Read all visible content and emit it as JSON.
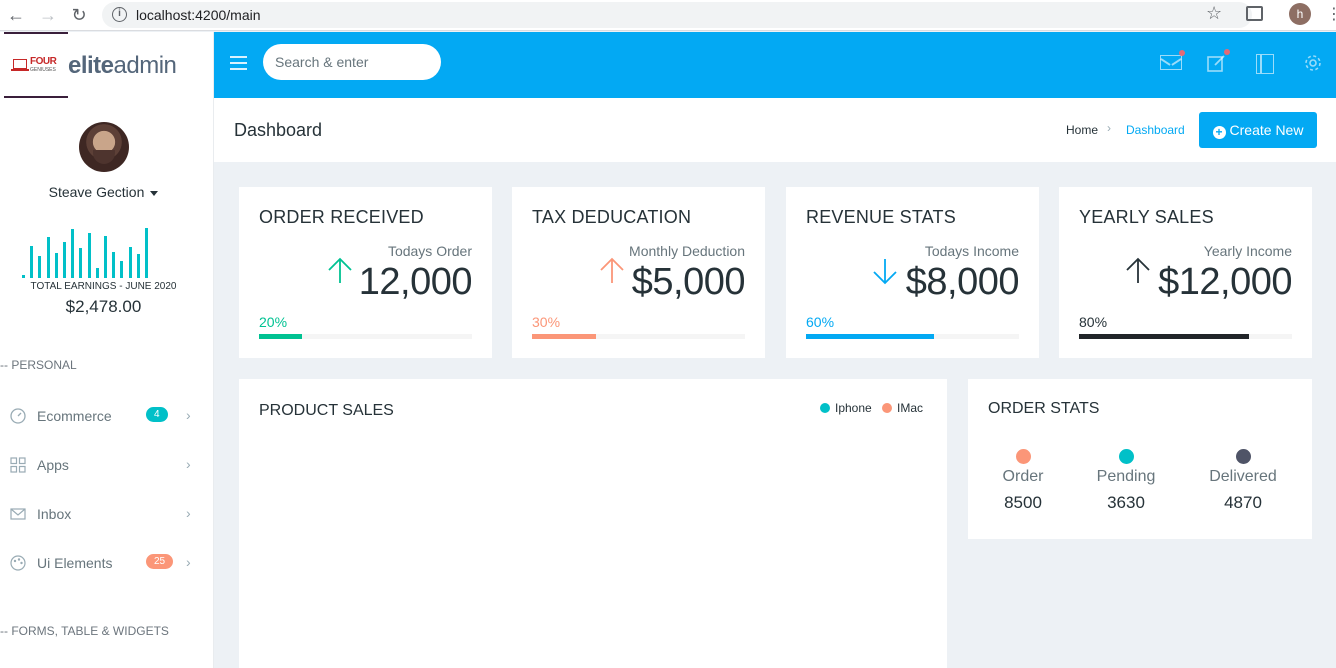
{
  "browser": {
    "url": "localhost:4200/main",
    "profile_initial": "h"
  },
  "brand": {
    "logo_top": "FOUR",
    "logo_bottom": "GENIUSES",
    "name_bold": "elite",
    "name_light": "admin"
  },
  "user": {
    "name": "Steave Gection"
  },
  "earnings": {
    "label": "TOTAL EARNINGS - JUNE 2020",
    "value": "$2,478.00",
    "spark_color": "#01c0c8",
    "bars": [
      0.06,
      0.62,
      0.42,
      0.78,
      0.48,
      0.7,
      0.94,
      0.58,
      0.86,
      0.2,
      0.8,
      0.5,
      0.32,
      0.6,
      0.46,
      0.96
    ]
  },
  "nav": {
    "personal_caption": "-- PERSONAL",
    "forms_caption": "-- FORMS, TABLE & WIDGETS",
    "items": [
      {
        "label": "Ecommerce",
        "icon": "gauge-icon",
        "badge": "4",
        "badge_color": "#01c0c8"
      },
      {
        "label": "Apps",
        "icon": "grid-icon",
        "badge": "",
        "badge_color": ""
      },
      {
        "label": "Inbox",
        "icon": "mail-icon",
        "badge": "",
        "badge_color": ""
      },
      {
        "label": "Ui Elements",
        "icon": "palette-icon",
        "badge": "25",
        "badge_color": "#fb9678"
      }
    ]
  },
  "topbar": {
    "search_placeholder": "Search & enter",
    "color": "#03a9f3",
    "icons": [
      "menu-icon",
      "mail-icon",
      "edit-icon",
      "panel-icon",
      "gear-icon"
    ]
  },
  "page": {
    "title": "Dashboard",
    "breadcrumb": [
      "Home",
      "Dashboard"
    ],
    "create_button": "Create New"
  },
  "stats": [
    {
      "title": "ORDER RECEIVED",
      "sub": "Todays Order",
      "value": "12,000",
      "percent_label": "20%",
      "percent": 20,
      "trend": "up",
      "color": "#00c292"
    },
    {
      "title": "TAX DEDUCATION",
      "sub": "Monthly Deduction",
      "value": "$5,000",
      "percent_label": "30%",
      "percent": 30,
      "trend": "up",
      "color": "#fb9678"
    },
    {
      "title": "REVENUE STATS",
      "sub": "Todays Income",
      "value": "$8,000",
      "percent_label": "60%",
      "percent": 60,
      "trend": "down",
      "color": "#03a9f3"
    },
    {
      "title": "YEARLY SALES",
      "sub": "Yearly Income",
      "value": "$12,000",
      "percent_label": "80%",
      "percent": 80,
      "trend": "up",
      "color": "#212529"
    }
  ],
  "product_sales": {
    "title": "PRODUCT SALES",
    "legend": [
      {
        "name": "Iphone",
        "color": "#01c0c8"
      },
      {
        "name": "IMac",
        "color": "#fb9678"
      }
    ]
  },
  "order_stats": {
    "title": "ORDER STATS",
    "items": [
      {
        "label": "Order",
        "value": "8500",
        "color": "#fb9678"
      },
      {
        "label": "Pending",
        "value": "3630",
        "color": "#01c0c8"
      },
      {
        "label": "Delivered",
        "value": "4870",
        "color": "#4f5467"
      }
    ]
  }
}
